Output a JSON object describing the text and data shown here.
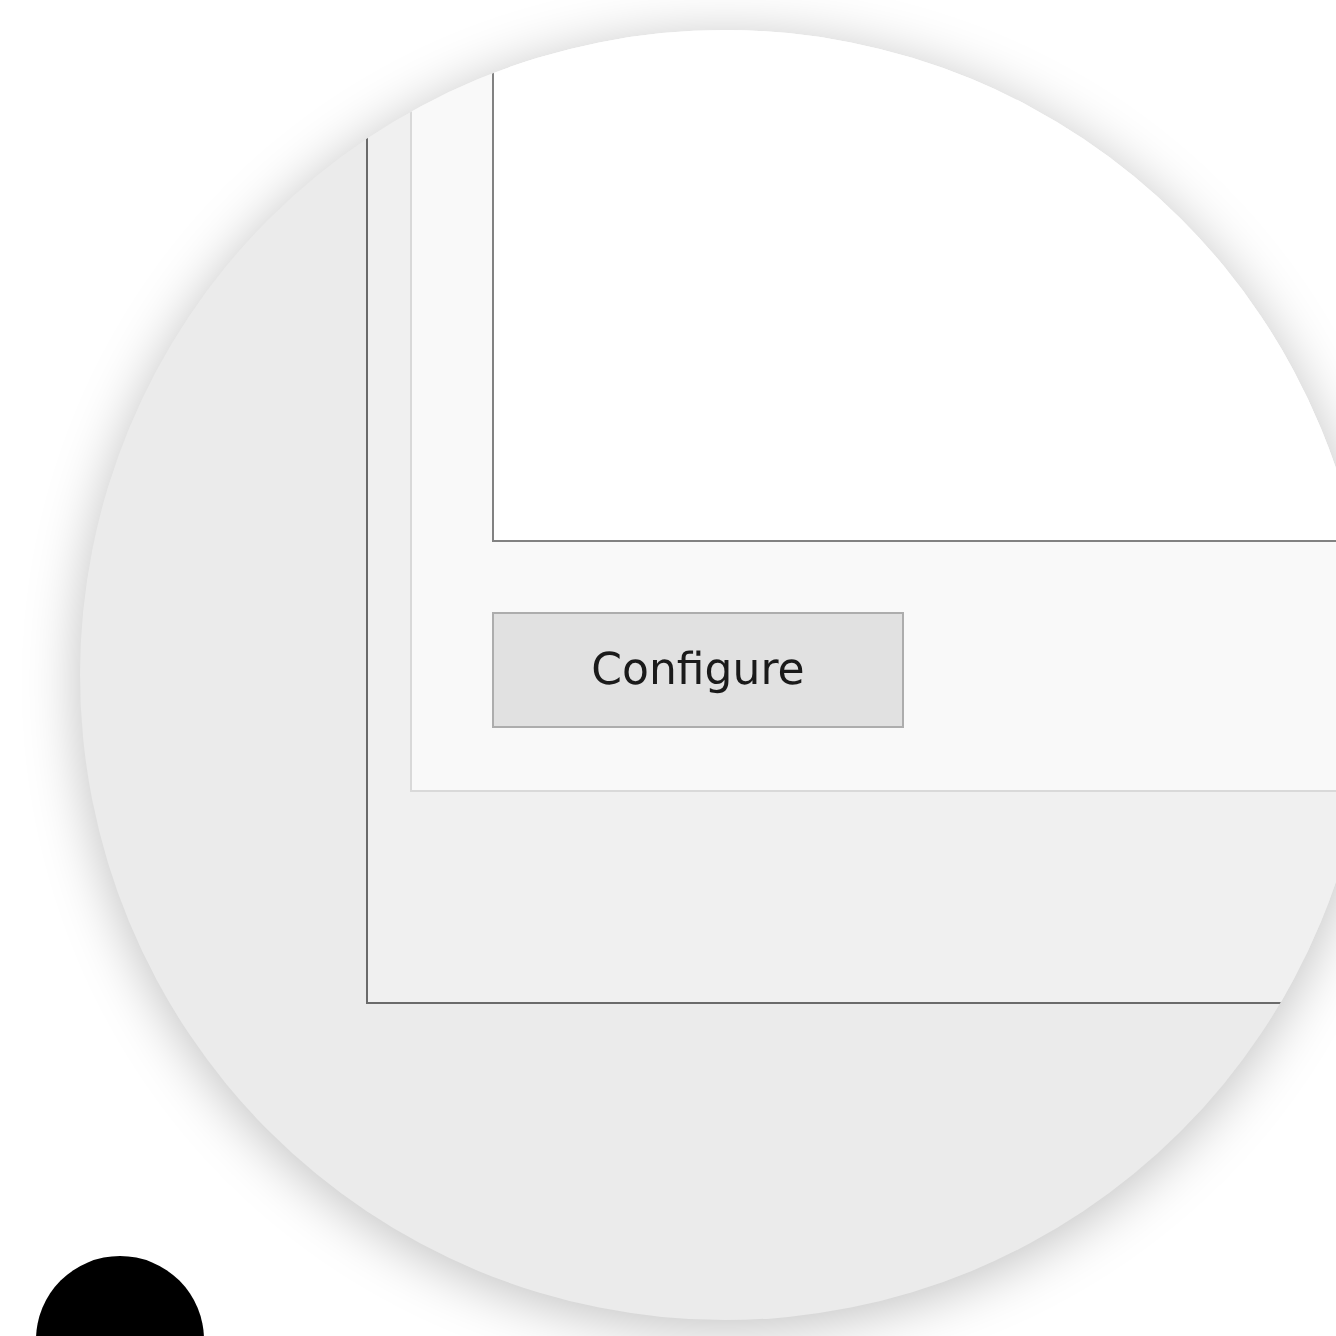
{
  "dialog": {
    "configure_button": {
      "label": "Configure"
    }
  }
}
